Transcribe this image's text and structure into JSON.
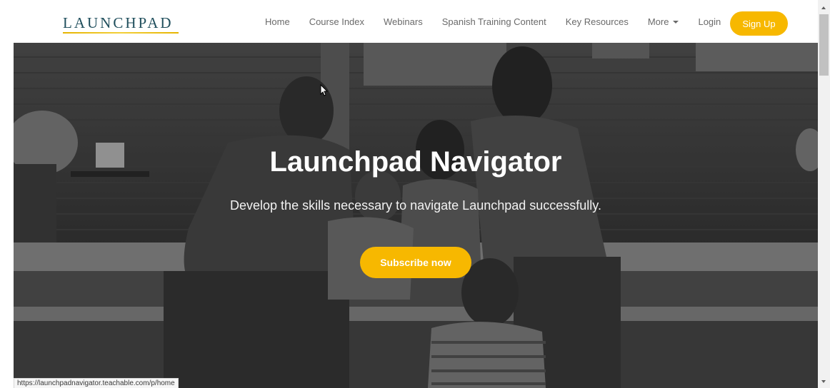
{
  "navbar": {
    "logo": "LAUNCHPAD",
    "links": [
      {
        "label": "Home"
      },
      {
        "label": "Course Index"
      },
      {
        "label": "Webinars"
      },
      {
        "label": "Spanish Training Content"
      },
      {
        "label": "Key Resources"
      },
      {
        "label": "More"
      },
      {
        "label": "Login"
      }
    ],
    "signup_label": "Sign Up"
  },
  "hero": {
    "title": "Launchpad Navigator",
    "subtitle": "Develop the skills necessary to navigate Launchpad successfully.",
    "cta_label": "Subscribe now",
    "background_image": "grayscale family photo on porch steps"
  },
  "status_bar": {
    "url": "https://launchpadnavigator.teachable.com/p/home"
  },
  "colors": {
    "accent": "#f7b800",
    "logo": "#1f4e5c",
    "nav_text": "#6a6a6a"
  },
  "icons": {
    "dropdown": "caret-down-icon",
    "cursor": "mouse-pointer-icon"
  }
}
